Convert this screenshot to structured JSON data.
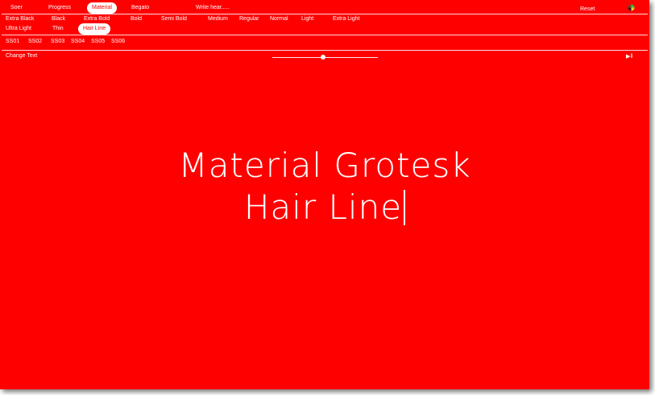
{
  "tabs": [
    {
      "label": "Soer",
      "active": false
    },
    {
      "label": "Progress",
      "active": false
    },
    {
      "label": "Material",
      "active": true
    },
    {
      "label": "Begato",
      "active": false
    }
  ],
  "write_here_label": "Write hear.....",
  "reset_label": "Reset",
  "weights_row1": [
    "Extra Black",
    "Black",
    "Extra Bold",
    "Bold",
    "Semi Bold",
    "Medium",
    "Regular",
    "Normal",
    "Light",
    "Extra Light"
  ],
  "weights_row2": [
    "Ultra Light",
    "Thin",
    "Hair Line"
  ],
  "selected_weight": "Hair Line",
  "stylistic_sets": [
    "SS01",
    "SS02",
    "SS03",
    "SS04",
    "SS05",
    "SS06"
  ],
  "change_text_label": "Change Text",
  "slider_value": 0.48,
  "preview": {
    "line1": "Material Grotesk",
    "line2": "Hair Line"
  },
  "colors": {
    "background": "#ff0000",
    "text": "#ffffff"
  },
  "icons": {
    "reset": "color-wheel-icon",
    "play": "play-pause-icon"
  }
}
